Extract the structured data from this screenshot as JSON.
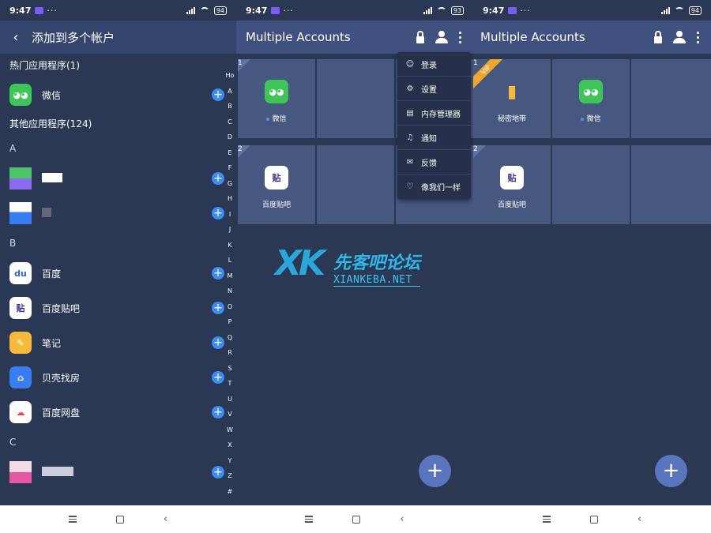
{
  "status": [
    {
      "time": "9:47",
      "dots": "···",
      "battery": "94"
    },
    {
      "time": "9:47",
      "dots": "···",
      "battery": "93"
    },
    {
      "time": "9:47",
      "dots": "···",
      "battery": "94"
    }
  ],
  "add_screen": {
    "title": "添加到多个帐户",
    "popular_header": "热门应用程序(1)",
    "popular": [
      {
        "label": "微信",
        "icon": "wechat-icon"
      }
    ],
    "other_header": "其他应用程序(124)",
    "letter_a": "A",
    "letter_b": "B",
    "letter_c": "C",
    "b_apps": [
      {
        "label": "百度",
        "icon": "baidu-icon"
      },
      {
        "label": "百度贴吧",
        "icon": "tieba-icon"
      },
      {
        "label": "笔记",
        "icon": "notes-icon"
      },
      {
        "label": "贝壳找房",
        "icon": "beike-icon"
      },
      {
        "label": "百度网盘",
        "icon": "netdisk-icon"
      }
    ],
    "alphabet": [
      "Ho",
      "A",
      "B",
      "C",
      "D",
      "E",
      "F",
      "G",
      "H",
      "I",
      "J",
      "K",
      "L",
      "M",
      "N",
      "O",
      "P",
      "Q",
      "R",
      "S",
      "T",
      "U",
      "V",
      "W",
      "X",
      "Y",
      "Z",
      "#"
    ]
  },
  "main_screen": {
    "title": "Multiple Accounts",
    "menu": [
      {
        "label": "登录",
        "icon": "person-outline-icon"
      },
      {
        "label": "设置",
        "icon": "gear-icon"
      },
      {
        "label": "内存管理器",
        "icon": "memory-icon"
      },
      {
        "label": "通知",
        "icon": "bell-icon"
      },
      {
        "label": "反馈",
        "icon": "feedback-icon"
      },
      {
        "label": "像我们一样",
        "icon": "heart-icon"
      }
    ],
    "slots": [
      {
        "num": "1",
        "app": "微信"
      },
      {
        "num": "2",
        "app": "百度贴吧"
      }
    ]
  },
  "third_screen": {
    "title": "Multiple Accounts",
    "slots": [
      {
        "num": "1",
        "app": "秘密地带",
        "badge": "VIP"
      },
      {
        "num": "",
        "app": "微信"
      },
      {
        "num": "2",
        "app": "百度贴吧"
      }
    ]
  },
  "watermark": {
    "cn": "先客吧论坛",
    "en": "XIANKEBA.NET",
    "logo": "XK"
  },
  "colors": {
    "appbar": "#405180",
    "background": "#2b3853",
    "accent": "#3d8cf0",
    "vip": "#f0a531"
  }
}
